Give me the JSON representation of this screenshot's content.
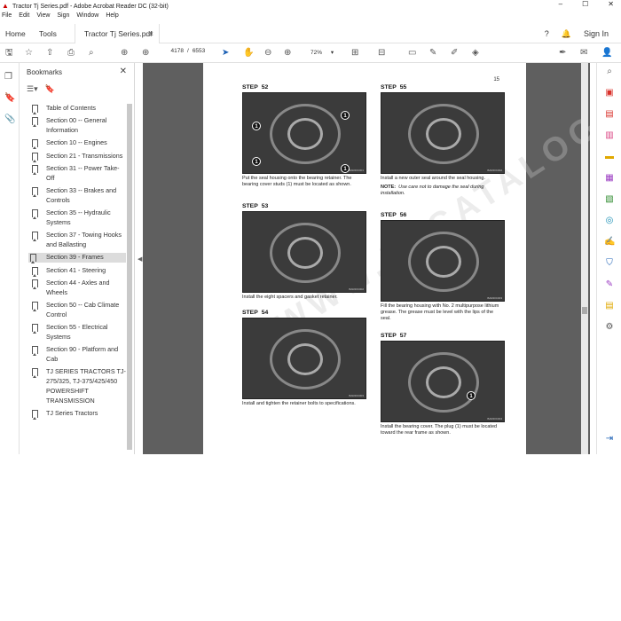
{
  "window": {
    "title": "Tractor Tj Series.pdf - Adobe Acrobat Reader DC (32-bit)",
    "controls": [
      "–",
      "☐",
      "✕"
    ]
  },
  "menu": [
    "File",
    "Edit",
    "View",
    "Sign",
    "Window",
    "Help"
  ],
  "tabs": {
    "home": "Home",
    "tools": "Tools",
    "doc": "Tractor Tj Series.pdf",
    "close": "×",
    "sign_in": "Sign In"
  },
  "toolbar": {
    "current_page": "4178",
    "total_pages": "6553",
    "zoom": "72%"
  },
  "bookmarks": {
    "title": "Bookmarks",
    "items": [
      {
        "label": "Table of Contents"
      },
      {
        "label": "Section 00 -- General Information"
      },
      {
        "label": "Section 10 -- Engines"
      },
      {
        "label": "Section 21 - Transmissions"
      },
      {
        "label": "Section 31 -- Power Take-Off"
      },
      {
        "label": "Section 33 -- Brakes and Controls"
      },
      {
        "label": "Section 35 -- Hydraulic Systems"
      },
      {
        "label": "Section 37 - Towing Hooks and Ballasting"
      },
      {
        "label": "Section 39 - Frames"
      },
      {
        "label": "Section 41 - Steering"
      },
      {
        "label": "Section 44 - Axles and Wheels"
      },
      {
        "label": "Section 50 -- Cab Climate Control"
      },
      {
        "label": "Section 55 - Electrical Systems"
      },
      {
        "label": "Section 90 - Platform and Cab"
      },
      {
        "label": "TJ SERIES TRACTORS TJ-275/325, TJ-375/425/450 POWERSHIFT TRANSMISSION"
      },
      {
        "label": "TJ Series Tractors"
      }
    ],
    "selected_index": 8
  },
  "page": {
    "number": "15",
    "watermark": "WWW.EPCATALOGS.COM",
    "steps": [
      {
        "label": "STEP",
        "num": "52",
        "caption": "Put the seal housing onto the bearing retainer. The bearing cover studs (1) must be located as shown.",
        "img_code": "BAR20C001",
        "callouts": [
          "1",
          "1",
          "1",
          "1"
        ]
      },
      {
        "label": "STEP",
        "num": "53",
        "caption": "Install the eight spacers and gasket retainer.",
        "img_code": "BAR20C002",
        "callouts": []
      },
      {
        "label": "STEP",
        "num": "54",
        "caption": "Install and tighten the retainer bolts to specifications.",
        "img_code": "BAR20C003",
        "callouts": []
      },
      {
        "label": "STEP",
        "num": "55",
        "caption": "Install a new outer seal around the seal housing.",
        "note_label": "NOTE:",
        "note": "Use care not to damage the seal during installation.",
        "img_code": "BAR20C002",
        "callouts": []
      },
      {
        "label": "STEP",
        "num": "56",
        "caption": "Fill the bearing housing with No. 2 multipurpose lithium grease. The grease must be level with the lips of the seal.",
        "img_code": "BAR20C003",
        "callouts": []
      },
      {
        "label": "STEP",
        "num": "57",
        "caption": "Install the bearing cover. The plug (1) must be located toward the rear frame as shown.",
        "img_code": "BAR20C004",
        "callouts": [
          "1"
        ]
      }
    ]
  }
}
